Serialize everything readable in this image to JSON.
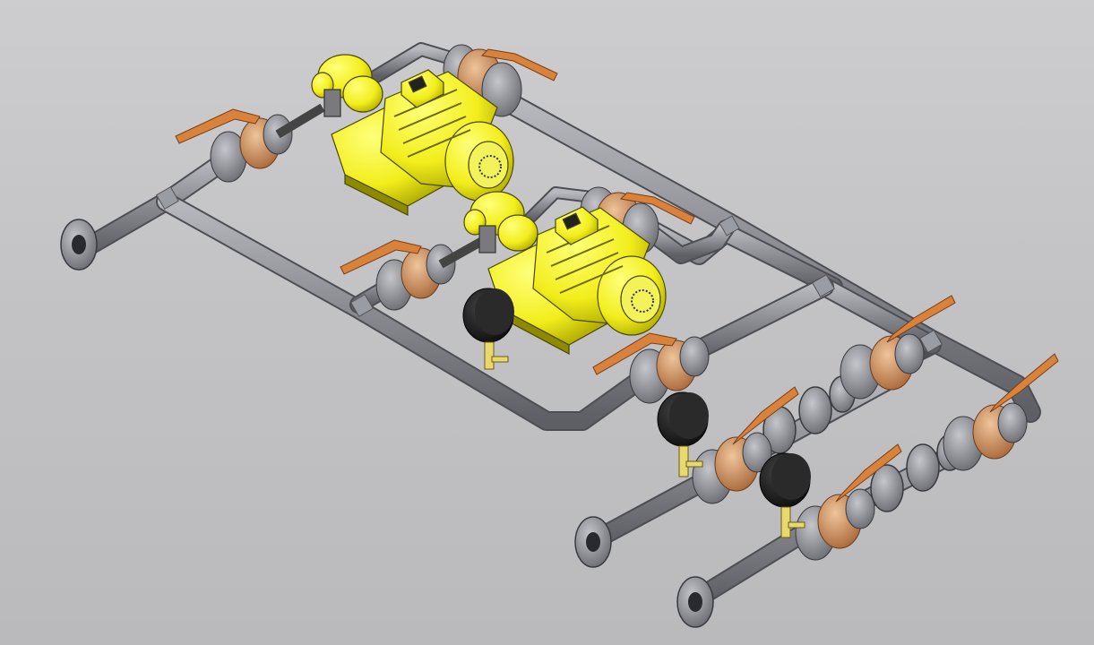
{
  "viewport": {
    "background_top": "#cdcdcf",
    "background_bottom": "#bababc"
  },
  "model": {
    "assemblies": [
      {
        "name": "pump-unit",
        "count": 2,
        "color": "#f2ee1c"
      },
      {
        "name": "ball-valve",
        "count": 8,
        "handle_color": "#d9823c",
        "body_color": "#d89a66"
      },
      {
        "name": "pressure-gauge",
        "count": 3,
        "face_color": "#1a1a1a"
      },
      {
        "name": "flange",
        "color": "#9a9ca3"
      },
      {
        "name": "pipe",
        "color": "#8d8e94"
      }
    ]
  }
}
